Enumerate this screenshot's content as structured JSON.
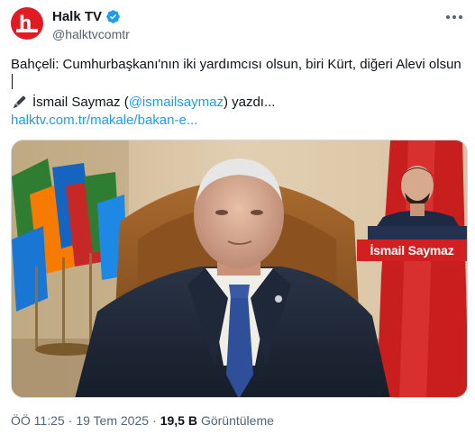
{
  "account": {
    "display_name": "Halk TV",
    "handle": "@halktvcomtr",
    "avatar_icon": "halktv-logo-icon",
    "verified_icon": "verified-badge-icon",
    "brand_color": "#e01b22",
    "verified_color": "#1d9bf0"
  },
  "tweet": {
    "text": "Bahçeli: Cumhurbaşkanı'nın iki yardımcısı olsun, biri Kürt, diğeri Alevi olsun",
    "author_icon": "pen-icon",
    "author_name": "İsmail Saymaz",
    "author_open": "(",
    "author_mention": "@ismailsaymaz",
    "author_suffix": ") yazdı...",
    "link": "halktv.com.tr/makale/bakan-e..."
  },
  "media": {
    "caption": "İsmail Saymaz",
    "caption_color": "#d21f1f"
  },
  "meta": {
    "time": "ÖÖ 11:25",
    "separator1": "·",
    "date": "19 Tem 2025",
    "separator2": "·",
    "views_count": "19,5 B",
    "views_label": "Görüntüleme"
  },
  "colors": {
    "text": "#0f1419",
    "secondary": "#536471",
    "link": "#1d9bf0"
  }
}
